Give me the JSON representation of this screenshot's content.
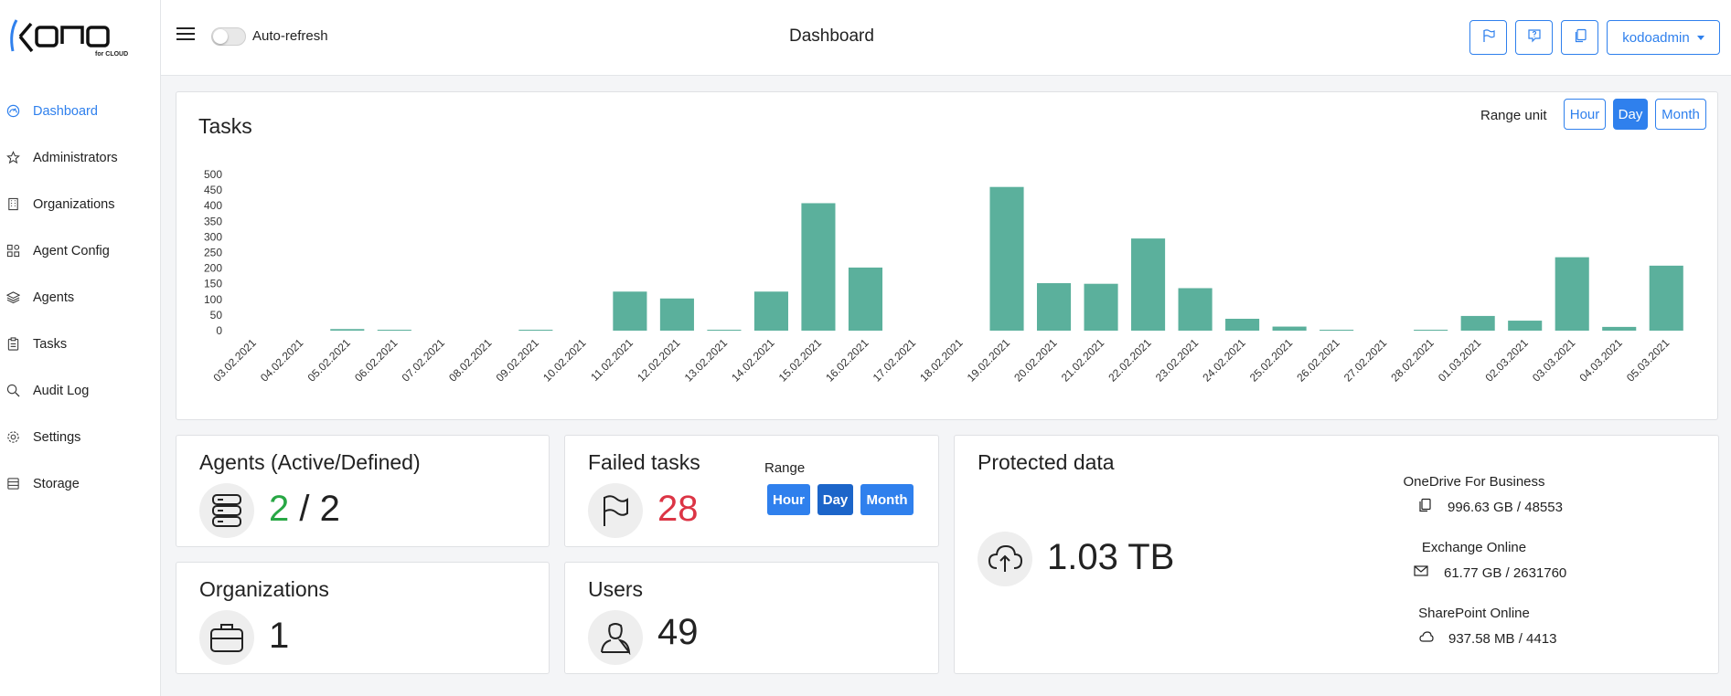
{
  "app": {
    "logo_text": "KODO",
    "logo_sub": "for CLOUD"
  },
  "sidebar": {
    "items": [
      {
        "label": "Dashboard",
        "icon": "dashboard-icon",
        "active": true
      },
      {
        "label": "Administrators",
        "icon": "star-icon",
        "active": false
      },
      {
        "label": "Organizations",
        "icon": "building-icon",
        "active": false
      },
      {
        "label": "Agent Config",
        "icon": "grid-icon",
        "active": false
      },
      {
        "label": "Agents",
        "icon": "layers-icon",
        "active": false
      },
      {
        "label": "Tasks",
        "icon": "clipboard-icon",
        "active": false
      },
      {
        "label": "Audit Log",
        "icon": "search-icon",
        "active": false
      },
      {
        "label": "Settings",
        "icon": "gear-icon",
        "active": false
      },
      {
        "label": "Storage",
        "icon": "storage-icon",
        "active": false
      }
    ]
  },
  "header": {
    "auto_refresh_label": "Auto-refresh",
    "auto_refresh_on": false,
    "title": "Dashboard",
    "user": "kodoadmin"
  },
  "tasks_card": {
    "title": "Tasks",
    "range_unit_label": "Range unit",
    "range_buttons": [
      "Hour",
      "Day",
      "Month"
    ],
    "active_range": "Day"
  },
  "chart_data": {
    "type": "bar",
    "title": "Tasks",
    "color": "#5bb09c",
    "ylim": [
      0,
      500
    ],
    "yticks": [
      0,
      50,
      100,
      150,
      200,
      250,
      300,
      350,
      400,
      450,
      500
    ],
    "categories": [
      "03.02.2021",
      "04.02.2021",
      "05.02.2021",
      "06.02.2021",
      "07.02.2021",
      "08.02.2021",
      "09.02.2021",
      "10.02.2021",
      "11.02.2021",
      "12.02.2021",
      "13.02.2021",
      "14.02.2021",
      "15.02.2021",
      "16.02.2021",
      "17.02.2021",
      "18.02.2021",
      "19.02.2021",
      "20.02.2021",
      "21.02.2021",
      "22.02.2021",
      "23.02.2021",
      "24.02.2021",
      "25.02.2021",
      "26.02.2021",
      "27.02.2021",
      "28.02.2021",
      "01.03.2021",
      "02.03.2021",
      "03.03.2021",
      "04.03.2021",
      "05.03.2021"
    ],
    "values": [
      0,
      0,
      5,
      1,
      0,
      0,
      1,
      0,
      125,
      103,
      2,
      125,
      408,
      202,
      0,
      0,
      460,
      152,
      150,
      295,
      136,
      38,
      13,
      2,
      0,
      2,
      47,
      32,
      235,
      12,
      208
    ]
  },
  "agents_card": {
    "title": "Agents (Active/Defined)",
    "active": "2",
    "separator": "/",
    "defined": "2"
  },
  "failed_card": {
    "title": "Failed tasks",
    "count": "28",
    "range_label": "Range",
    "range_buttons": [
      "Hour",
      "Day",
      "Month"
    ],
    "active_range": "Day"
  },
  "organizations_card": {
    "title": "Organizations",
    "count": "1"
  },
  "users_card": {
    "title": "Users",
    "count": "49"
  },
  "protected_card": {
    "title": "Protected data",
    "total": "1.03 TB",
    "services": [
      {
        "name": "OneDrive For Business",
        "value": "996.63 GB / 48553",
        "icon": "files-icon"
      },
      {
        "name": "Exchange Online",
        "value": "61.77 GB / 2631760",
        "icon": "mail-icon"
      },
      {
        "name": "SharePoint Online",
        "value": "937.58 MB / 4413",
        "icon": "cloud-icon"
      }
    ]
  },
  "colors": {
    "accent": "#2f80ed",
    "green": "#28a745",
    "red": "#dc3545",
    "bar": "#5bb09c"
  }
}
